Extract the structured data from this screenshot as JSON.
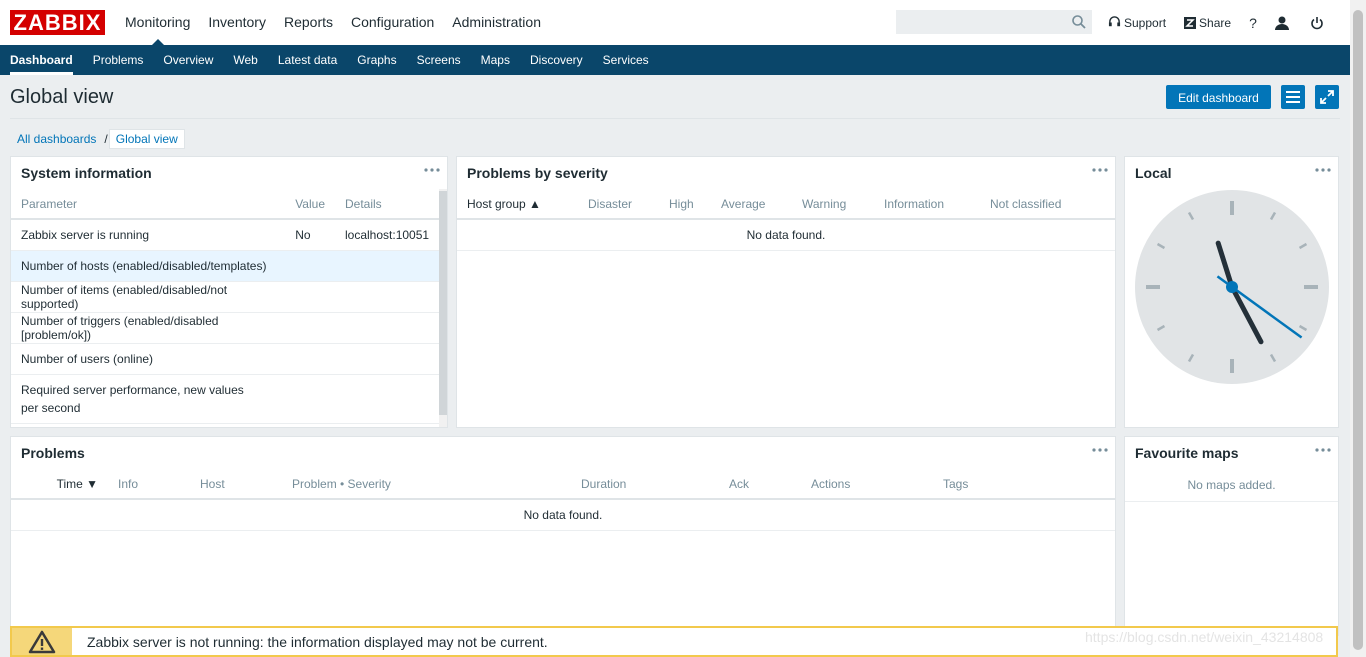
{
  "logo": "ZABBIX",
  "topnav": [
    "Monitoring",
    "Inventory",
    "Reports",
    "Configuration",
    "Administration"
  ],
  "search": {
    "placeholder": "",
    "value": ""
  },
  "tools": {
    "support": "Support",
    "share": "Share",
    "help": "?"
  },
  "subnav": [
    "Dashboard",
    "Problems",
    "Overview",
    "Web",
    "Latest data",
    "Graphs",
    "Screens",
    "Maps",
    "Discovery",
    "Services"
  ],
  "page": {
    "title": "Global view",
    "edit_label": "Edit dashboard"
  },
  "breadcrumb": {
    "root": "All dashboards",
    "sep": "/",
    "current": "Global view"
  },
  "system_info": {
    "title": "System information",
    "columns": [
      "Parameter",
      "Value",
      "Details"
    ],
    "rows": [
      {
        "param": "Zabbix server is running",
        "value": "No",
        "details": "localhost:10051"
      },
      {
        "param": "Number of hosts (enabled/disabled/templates)",
        "value": "",
        "details": ""
      },
      {
        "param": "Number of items (enabled/disabled/not supported)",
        "value": "",
        "details": ""
      },
      {
        "param": "Number of triggers (enabled/disabled [problem/ok])",
        "value": "",
        "details": ""
      },
      {
        "param": "Number of users (online)",
        "value": "",
        "details": ""
      },
      {
        "param": "Required server performance, new values per second",
        "value": "",
        "details": ""
      }
    ]
  },
  "severity": {
    "title": "Problems by severity",
    "columns": [
      "Host group ▲",
      "Disaster",
      "High",
      "Average",
      "Warning",
      "Information",
      "Not classified"
    ],
    "empty": "No data found."
  },
  "clock": {
    "title": "Local",
    "hour": 11,
    "minute": 25,
    "second": 21
  },
  "problems": {
    "title": "Problems",
    "columns": [
      "Time ▼",
      "Info",
      "Host",
      "Problem • Severity",
      "Duration",
      "Ack",
      "Actions",
      "Tags"
    ],
    "empty": "No data found."
  },
  "fav_maps": {
    "title": "Favourite maps",
    "empty": "No maps added."
  },
  "warning": "Zabbix server is not running: the information displayed may not be current.",
  "watermark": "https://blog.csdn.net/weixin_43214808",
  "colors": {
    "brand": "#d40000",
    "nav": "#0a466a",
    "accent": "#0275b8",
    "warning": "#f2c94c"
  }
}
